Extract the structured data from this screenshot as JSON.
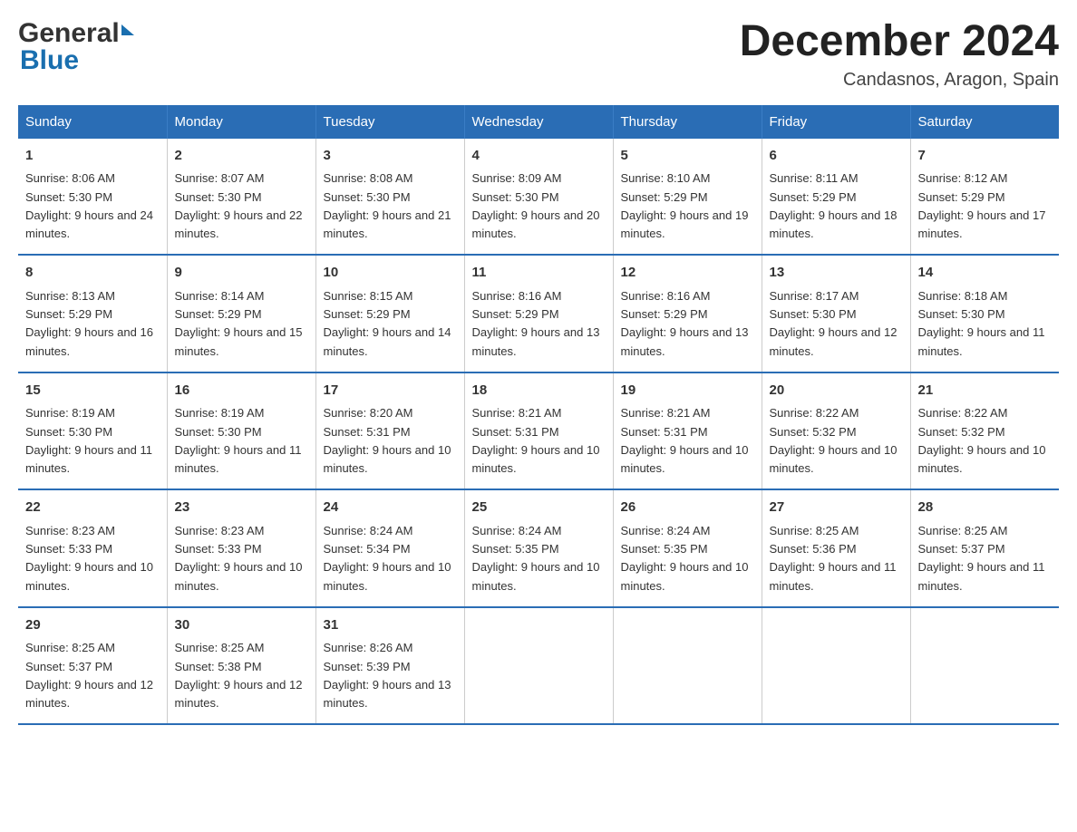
{
  "logo": {
    "general_text": "General",
    "blue_text": "Blue"
  },
  "title": "December 2024",
  "subtitle": "Candasnos, Aragon, Spain",
  "headers": [
    "Sunday",
    "Monday",
    "Tuesday",
    "Wednesday",
    "Thursday",
    "Friday",
    "Saturday"
  ],
  "weeks": [
    [
      {
        "day": "1",
        "sunrise": "Sunrise: 8:06 AM",
        "sunset": "Sunset: 5:30 PM",
        "daylight": "Daylight: 9 hours and 24 minutes."
      },
      {
        "day": "2",
        "sunrise": "Sunrise: 8:07 AM",
        "sunset": "Sunset: 5:30 PM",
        "daylight": "Daylight: 9 hours and 22 minutes."
      },
      {
        "day": "3",
        "sunrise": "Sunrise: 8:08 AM",
        "sunset": "Sunset: 5:30 PM",
        "daylight": "Daylight: 9 hours and 21 minutes."
      },
      {
        "day": "4",
        "sunrise": "Sunrise: 8:09 AM",
        "sunset": "Sunset: 5:30 PM",
        "daylight": "Daylight: 9 hours and 20 minutes."
      },
      {
        "day": "5",
        "sunrise": "Sunrise: 8:10 AM",
        "sunset": "Sunset: 5:29 PM",
        "daylight": "Daylight: 9 hours and 19 minutes."
      },
      {
        "day": "6",
        "sunrise": "Sunrise: 8:11 AM",
        "sunset": "Sunset: 5:29 PM",
        "daylight": "Daylight: 9 hours and 18 minutes."
      },
      {
        "day": "7",
        "sunrise": "Sunrise: 8:12 AM",
        "sunset": "Sunset: 5:29 PM",
        "daylight": "Daylight: 9 hours and 17 minutes."
      }
    ],
    [
      {
        "day": "8",
        "sunrise": "Sunrise: 8:13 AM",
        "sunset": "Sunset: 5:29 PM",
        "daylight": "Daylight: 9 hours and 16 minutes."
      },
      {
        "day": "9",
        "sunrise": "Sunrise: 8:14 AM",
        "sunset": "Sunset: 5:29 PM",
        "daylight": "Daylight: 9 hours and 15 minutes."
      },
      {
        "day": "10",
        "sunrise": "Sunrise: 8:15 AM",
        "sunset": "Sunset: 5:29 PM",
        "daylight": "Daylight: 9 hours and 14 minutes."
      },
      {
        "day": "11",
        "sunrise": "Sunrise: 8:16 AM",
        "sunset": "Sunset: 5:29 PM",
        "daylight": "Daylight: 9 hours and 13 minutes."
      },
      {
        "day": "12",
        "sunrise": "Sunrise: 8:16 AM",
        "sunset": "Sunset: 5:29 PM",
        "daylight": "Daylight: 9 hours and 13 minutes."
      },
      {
        "day": "13",
        "sunrise": "Sunrise: 8:17 AM",
        "sunset": "Sunset: 5:30 PM",
        "daylight": "Daylight: 9 hours and 12 minutes."
      },
      {
        "day": "14",
        "sunrise": "Sunrise: 8:18 AM",
        "sunset": "Sunset: 5:30 PM",
        "daylight": "Daylight: 9 hours and 11 minutes."
      }
    ],
    [
      {
        "day": "15",
        "sunrise": "Sunrise: 8:19 AM",
        "sunset": "Sunset: 5:30 PM",
        "daylight": "Daylight: 9 hours and 11 minutes."
      },
      {
        "day": "16",
        "sunrise": "Sunrise: 8:19 AM",
        "sunset": "Sunset: 5:30 PM",
        "daylight": "Daylight: 9 hours and 11 minutes."
      },
      {
        "day": "17",
        "sunrise": "Sunrise: 8:20 AM",
        "sunset": "Sunset: 5:31 PM",
        "daylight": "Daylight: 9 hours and 10 minutes."
      },
      {
        "day": "18",
        "sunrise": "Sunrise: 8:21 AM",
        "sunset": "Sunset: 5:31 PM",
        "daylight": "Daylight: 9 hours and 10 minutes."
      },
      {
        "day": "19",
        "sunrise": "Sunrise: 8:21 AM",
        "sunset": "Sunset: 5:31 PM",
        "daylight": "Daylight: 9 hours and 10 minutes."
      },
      {
        "day": "20",
        "sunrise": "Sunrise: 8:22 AM",
        "sunset": "Sunset: 5:32 PM",
        "daylight": "Daylight: 9 hours and 10 minutes."
      },
      {
        "day": "21",
        "sunrise": "Sunrise: 8:22 AM",
        "sunset": "Sunset: 5:32 PM",
        "daylight": "Daylight: 9 hours and 10 minutes."
      }
    ],
    [
      {
        "day": "22",
        "sunrise": "Sunrise: 8:23 AM",
        "sunset": "Sunset: 5:33 PM",
        "daylight": "Daylight: 9 hours and 10 minutes."
      },
      {
        "day": "23",
        "sunrise": "Sunrise: 8:23 AM",
        "sunset": "Sunset: 5:33 PM",
        "daylight": "Daylight: 9 hours and 10 minutes."
      },
      {
        "day": "24",
        "sunrise": "Sunrise: 8:24 AM",
        "sunset": "Sunset: 5:34 PM",
        "daylight": "Daylight: 9 hours and 10 minutes."
      },
      {
        "day": "25",
        "sunrise": "Sunrise: 8:24 AM",
        "sunset": "Sunset: 5:35 PM",
        "daylight": "Daylight: 9 hours and 10 minutes."
      },
      {
        "day": "26",
        "sunrise": "Sunrise: 8:24 AM",
        "sunset": "Sunset: 5:35 PM",
        "daylight": "Daylight: 9 hours and 10 minutes."
      },
      {
        "day": "27",
        "sunrise": "Sunrise: 8:25 AM",
        "sunset": "Sunset: 5:36 PM",
        "daylight": "Daylight: 9 hours and 11 minutes."
      },
      {
        "day": "28",
        "sunrise": "Sunrise: 8:25 AM",
        "sunset": "Sunset: 5:37 PM",
        "daylight": "Daylight: 9 hours and 11 minutes."
      }
    ],
    [
      {
        "day": "29",
        "sunrise": "Sunrise: 8:25 AM",
        "sunset": "Sunset: 5:37 PM",
        "daylight": "Daylight: 9 hours and 12 minutes."
      },
      {
        "day": "30",
        "sunrise": "Sunrise: 8:25 AM",
        "sunset": "Sunset: 5:38 PM",
        "daylight": "Daylight: 9 hours and 12 minutes."
      },
      {
        "day": "31",
        "sunrise": "Sunrise: 8:26 AM",
        "sunset": "Sunset: 5:39 PM",
        "daylight": "Daylight: 9 hours and 13 minutes."
      },
      null,
      null,
      null,
      null
    ]
  ]
}
